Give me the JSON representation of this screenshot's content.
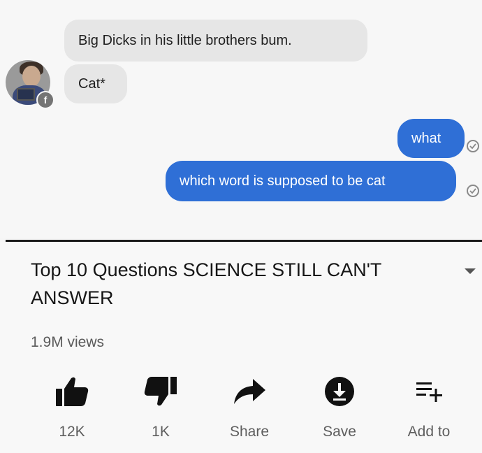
{
  "chat": {
    "incoming": [
      "Big Dicks in his little brothers bum.",
      "Cat*"
    ],
    "outgoing": [
      "what",
      "which word is supposed to be cat"
    ],
    "colors": {
      "incoming_bubble": "#e6e6e6",
      "outgoing_bubble": "#2f6fd6"
    }
  },
  "video": {
    "title": "Top 10 Questions SCIENCE STILL CAN'T ANSWER",
    "views": "1.9M views",
    "actions": [
      {
        "icon": "thumbs-up-icon",
        "label": "12K"
      },
      {
        "icon": "thumbs-down-icon",
        "label": "1K"
      },
      {
        "icon": "share-arrow-icon",
        "label": "Share"
      },
      {
        "icon": "download-icon",
        "label": "Save"
      },
      {
        "icon": "add-to-playlist-icon",
        "label": "Add to"
      }
    ]
  }
}
